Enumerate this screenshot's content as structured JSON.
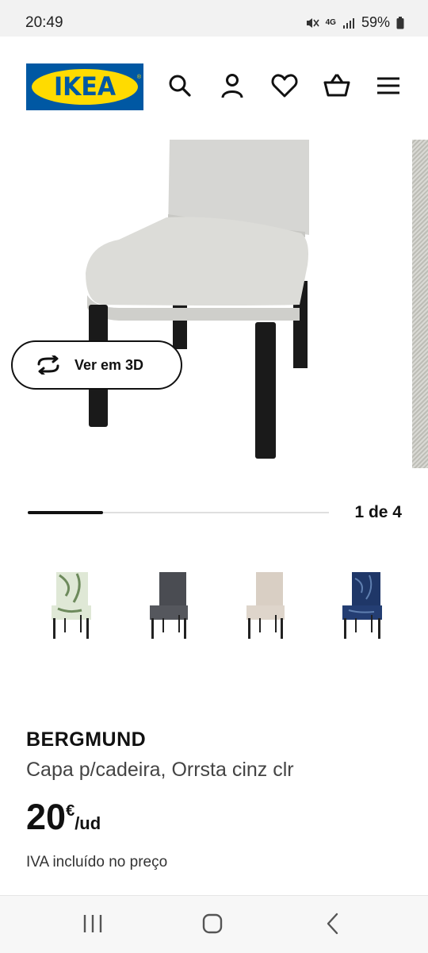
{
  "status": {
    "time": "20:49",
    "network": "4G",
    "battery": "59%"
  },
  "header": {
    "logo": "IKEA",
    "icons": [
      "search-icon",
      "account-icon",
      "favourites-icon",
      "basket-icon",
      "menu-icon"
    ]
  },
  "gallery": {
    "view3d_label": "Ver em 3D",
    "position": "1 de 4",
    "progress": 0.25,
    "thumbnails": [
      "green-leaf-pattern",
      "dark-grey",
      "beige",
      "dark-blue-pattern"
    ]
  },
  "product": {
    "name": "BERGMUND",
    "description": "Capa p/cadeira, Orrsta cinz clr",
    "price_int": "20",
    "currency": "€",
    "unit": "/ud",
    "vat_note": "IVA incluído no preço"
  },
  "colors": {
    "ikea_blue": "#0058a3",
    "ikea_yellow": "#ffdb00"
  }
}
